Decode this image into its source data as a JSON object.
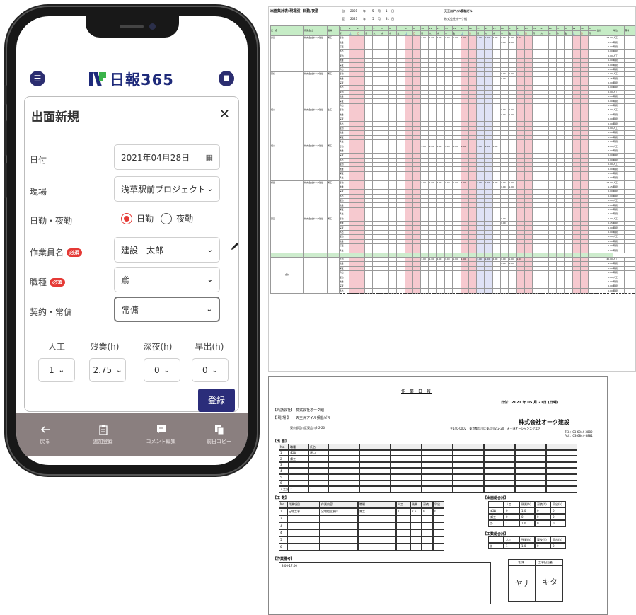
{
  "phone": {
    "app_name": "日報365",
    "menu_icon": "menu-icon",
    "user_icon": "user-icon",
    "form": {
      "title": "出面新規",
      "close": "✕",
      "date_label": "日付",
      "date_value": "2021年04月28日",
      "site_label": "現場",
      "site_value": "浅草駅前プロジェクト",
      "shift_label": "日勤・夜勤",
      "shift_day": "日勤",
      "shift_night": "夜勤",
      "worker_label": "作業員名",
      "worker_value": "建設　太郎",
      "job_label": "職種",
      "job_value": "鳶",
      "contract_label": "契約・常傭",
      "contract_value": "常傭",
      "required_badge": "必須",
      "cols": [
        {
          "label": "人工",
          "value": "1"
        },
        {
          "label": "残業(h)",
          "value": "2.75"
        },
        {
          "label": "深夜(h)",
          "value": "0"
        },
        {
          "label": "早出(h)",
          "value": "0"
        }
      ],
      "submit": "登録"
    },
    "tabs": [
      {
        "label": "戻る",
        "icon": "back-arrow-icon"
      },
      {
        "label": "追加登録",
        "icon": "clipboard-icon"
      },
      {
        "label": "コメント編集",
        "icon": "comment-icon"
      },
      {
        "label": "前日コピー",
        "icon": "copy-icon"
      }
    ]
  },
  "sheet1": {
    "title": "出面集計表(現場別) 日勤/夜勤",
    "from_label": "自",
    "to_label": "至",
    "year": "2021",
    "nen": "年",
    "tsuki": "月",
    "nichi": "日",
    "from_month": "5",
    "from_day": "1",
    "to_month": "5",
    "to_day": "31",
    "site": "天王洲アイル郵船ビル",
    "company": "株式会社オーク組",
    "headers": {
      "name": "氏　名",
      "affiliation": "所属会社",
      "job": "職種",
      "day_label": "日",
      "week_label": "曜",
      "total": "合計",
      "unit": "単位",
      "note": "備考"
    },
    "weekdays": [
      "土",
      "日",
      "月",
      "火",
      "水",
      "木",
      "金",
      "土",
      "日",
      "月",
      "火",
      "水",
      "木",
      "金",
      "土",
      "日",
      "月",
      "火",
      "水",
      "木",
      "金",
      "土",
      "日",
      "月",
      "火",
      "水",
      "木",
      "金",
      "土",
      "日",
      "月"
    ],
    "row_types": [
      "日勤",
      "残業",
      "深夜",
      "早出",
      "夜勤",
      "残業",
      "深夜",
      "早出"
    ],
    "units": [
      "人工",
      "時間",
      "時間",
      "時間",
      "人工",
      "時間",
      "時間",
      "時間"
    ],
    "blocks": [
      {
        "name": "井口",
        "company": "株式会社オーク建設",
        "job": "鳶工",
        "totals": [
          "13.00",
          "3.25",
          "0.00",
          "0.00",
          "0.00",
          "0.00",
          "0.00",
          "0.00"
        ]
      },
      {
        "name": "菅谷",
        "company": "株式会社オーク建設",
        "job": "鳶工",
        "totals": [
          "1.00",
          "0.25",
          "0.00",
          "0.00",
          "0.00",
          "0.00",
          "0.00",
          "0.00"
        ]
      },
      {
        "name": "堀川",
        "company": "株式会社オーク建設",
        "job": "土工",
        "totals": [
          "3.00",
          "1.00",
          "0.00",
          "0.00",
          "0.00",
          "0.00",
          "0.00",
          "0.00"
        ]
      },
      {
        "name": "堀川",
        "company": "株式会社オーク建設",
        "job": "鳶工",
        "totals": [
          "9.00",
          "0.00",
          "0.00",
          "0.00",
          "0.00",
          "0.00",
          "0.00",
          "0.00"
        ]
      },
      {
        "name": "横田",
        "company": "株式会社オーク建設",
        "job": "鳶工",
        "totals": [
          "13.00",
          "1.25",
          "0.00",
          "0.00",
          "0.00",
          "0.00",
          "0.00",
          "0.00"
        ]
      },
      {
        "name": "葛西",
        "company": "株式会社オーク建設",
        "job": "鳶工",
        "totals": [
          "1.00",
          "0.25",
          "0.00",
          "0.00",
          "0.00",
          "0.00",
          "0.00",
          "0.00"
        ]
      }
    ],
    "grand_label": "合計",
    "grand_totals": [
      "40.00",
      "4.00",
      "0.00",
      "0.00",
      "0.00",
      "0.00",
      "0.00",
      "0.00"
    ],
    "cell_value": "1.00"
  },
  "sheet2": {
    "title": "作 業 日 報",
    "date": "日付：2021 年 05 月 21日 (日曜)",
    "client_label": "【元請会社】",
    "client": "株式会社オーク組",
    "site_label": "【 現 場 】",
    "site": "天王洲アイル郵船ビル",
    "address": "東京都品川区東品川2-2-20",
    "company": "株式会社オーク建設",
    "company_addr": "〒140-0002　東京都品川区東品川2-2-20　天王洲オーシャンスクエア",
    "tel": "TEL：03-6844-3880",
    "fax": "FAX：03-6844-3881",
    "attendance_label": "【出 面】",
    "att_headers": [
      "No.",
      "職種",
      "氏名"
    ],
    "att_rows": [
      [
        "1",
        "鳶職",
        "堀口"
      ],
      [
        "2",
        "鳶工",
        ""
      ],
      [
        "3",
        "",
        ""
      ],
      [
        "4",
        "",
        ""
      ],
      [
        "5",
        "",
        ""
      ],
      [
        "6",
        "",
        ""
      ]
    ],
    "att_total_label": "人工計",
    "att_total_a": "2",
    "att_total_b": "1",
    "work_label": "【工 数】",
    "work_headers": [
      "No.",
      "作業項目",
      "作業内容",
      "職種",
      "人工",
      "残業",
      "深夜",
      "早出"
    ],
    "work_rows": [
      [
        "1",
        "足場工事",
        "足場組立解体",
        "鳶工",
        "1",
        "2.5",
        "0",
        "0"
      ],
      [
        "2",
        "",
        "",
        "",
        "",
        "",
        "",
        ""
      ],
      [
        "3",
        "",
        "",
        "",
        "",
        "",
        "",
        ""
      ],
      [
        "4",
        "",
        "",
        "",
        "",
        "",
        "",
        ""
      ],
      [
        "5",
        "",
        "",
        "",
        "",
        "",
        "",
        ""
      ],
      [
        "6",
        "",
        "",
        "",
        "",
        "",
        "",
        ""
      ]
    ],
    "summary1_label": "【出面総合計】",
    "summary2_label": "【工数総合計】",
    "sum_headers": [
      "人工",
      "残業(h)",
      "深夜(h)",
      "早出(h)"
    ],
    "sum1_rows": [
      [
        "鳶職",
        "0",
        "1.0",
        "0",
        "0"
      ],
      [
        "鳶工",
        "0",
        "0",
        "0",
        "0"
      ],
      [
        "計",
        "1",
        "1.0",
        "0",
        "0"
      ]
    ],
    "sum2_rows": [
      [
        "計",
        "1",
        "1.0",
        "0",
        "0"
      ]
    ],
    "remarks_label": "【作業備考】",
    "remarks": "8:00-17:00",
    "sign_headers": [
      "名 簿",
      "工事担当者"
    ],
    "signatures": [
      "ヤナ",
      "キタ"
    ]
  }
}
